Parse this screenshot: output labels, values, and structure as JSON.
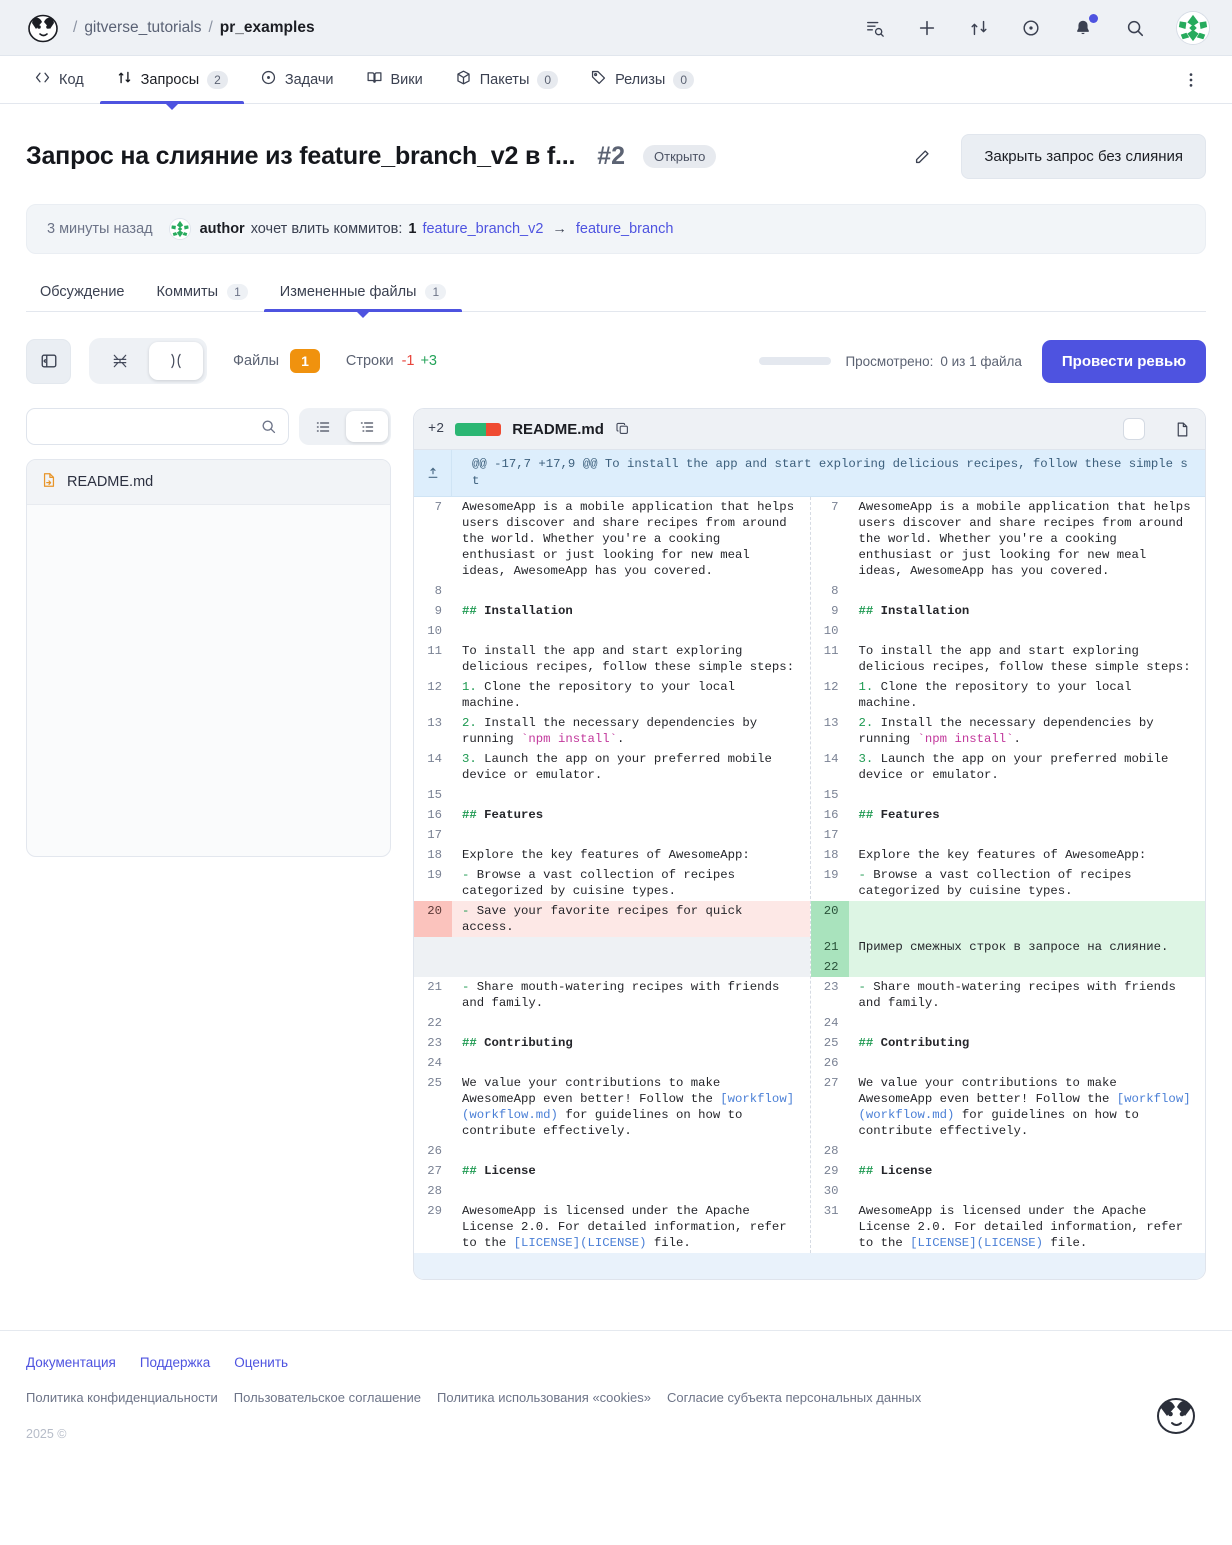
{
  "topbar": {
    "breadcrumb": {
      "org": "gitverse_tutorials",
      "repo": "pr_examples",
      "sep": "/"
    },
    "actions": [
      {
        "name": "list-search-icon",
        "label": "Поиск по списку"
      },
      {
        "name": "plus-icon",
        "label": "Создать"
      },
      {
        "name": "pull-request-icon",
        "label": "Запросы на слияние"
      },
      {
        "name": "issues-icon",
        "label": "Задачи"
      },
      {
        "name": "bell-icon",
        "label": "Уведомления"
      },
      {
        "name": "search-icon",
        "label": "Поиск"
      }
    ]
  },
  "repo_nav": {
    "items": [
      {
        "label": "Код",
        "count": null,
        "icon": "code-icon",
        "active": false
      },
      {
        "label": "Запросы",
        "count": "2",
        "icon": "pull-request-icon",
        "active": true
      },
      {
        "label": "Задачи",
        "count": null,
        "icon": "issues-icon",
        "active": false
      },
      {
        "label": "Вики",
        "count": null,
        "icon": "book-icon",
        "active": false
      },
      {
        "label": "Пакеты",
        "count": "0",
        "icon": "package-icon",
        "active": false
      },
      {
        "label": "Релизы",
        "count": "0",
        "icon": "tag-icon",
        "active": false
      }
    ]
  },
  "pr": {
    "title": "Запрос на слияние из feature_branch_v2 в f...",
    "number": "#2",
    "state": "Открыто",
    "close_button": "Закрыть запрос без слияния",
    "meta": {
      "time": "3 минуты назад",
      "author": "author",
      "text": "хочет влить коммитов:",
      "commits": "1",
      "source_branch": "feature_branch_v2",
      "arrow": "→",
      "target_branch": "feature_branch"
    }
  },
  "subtabs": [
    {
      "label": "Обсуждение",
      "count": null,
      "active": false
    },
    {
      "label": "Коммиты",
      "count": "1",
      "active": false
    },
    {
      "label": "Измененные файлы",
      "count": "1",
      "active": true
    }
  ],
  "toolbar": {
    "collapse_icon": "sidebar-collapse-icon",
    "view_unified": "unified-view-icon",
    "view_split": "split-view-icon",
    "files_label": "Файлы",
    "files_count": "1",
    "lines_label": "Строки",
    "lines_deleted": "-1",
    "lines_added": "+3",
    "viewed_label": "Просмотрено:",
    "viewed_value": "0 из 1 файла",
    "review_button": "Провести ревью"
  },
  "filepane": {
    "search_placeholder": "",
    "search_value": "",
    "view_flat": "flat-list-icon",
    "view_tree": "tree-list-icon",
    "files": [
      {
        "name": "README.md",
        "status": "modified"
      }
    ]
  },
  "diff": {
    "added_count": "+2",
    "filename": "README.md",
    "copy_icon": "copy-icon",
    "viewed_checkbox": false,
    "file_icon": "file-icon",
    "hunk_header": "@@ -17,7 +17,9 @@ To install the app and start exploring delicious recipes, follow these simple st",
    "left": [
      {
        "n": "7",
        "type": "ctx",
        "text": "AwesomeApp is a mobile application that helps users discover and share recipes from around the world. Whether you're a cooking enthusiast or just looking for new meal ideas, AwesomeApp has you covered."
      },
      {
        "n": "8",
        "type": "ctx",
        "text": ""
      },
      {
        "n": "9",
        "type": "ctx",
        "text": "## Installation",
        "md": "heading"
      },
      {
        "n": "10",
        "type": "ctx",
        "text": ""
      },
      {
        "n": "11",
        "type": "ctx",
        "text": "To install the app and start exploring delicious recipes, follow these simple steps:"
      },
      {
        "n": "12",
        "type": "ctx",
        "text": "1. Clone the repository to your local machine.",
        "md": "ol"
      },
      {
        "n": "13",
        "type": "ctx",
        "text": "2. Install the necessary dependencies by running `npm install`.",
        "md": "ol-code"
      },
      {
        "n": "14",
        "type": "ctx",
        "text": "3. Launch the app on your preferred mobile device or emulator.",
        "md": "ol"
      },
      {
        "n": "15",
        "type": "ctx",
        "text": ""
      },
      {
        "n": "16",
        "type": "ctx",
        "text": "## Features",
        "md": "heading"
      },
      {
        "n": "17",
        "type": "ctx",
        "text": ""
      },
      {
        "n": "18",
        "type": "ctx",
        "text": "Explore the key features of AwesomeApp:"
      },
      {
        "n": "19",
        "type": "ctx",
        "text": "- Browse a vast collection of recipes categorized by cuisine types.",
        "md": "ul"
      },
      {
        "n": "20",
        "type": "del",
        "text": "- Save your favorite recipes for quick access.",
        "md": "ul"
      },
      {
        "n": "",
        "type": "empty",
        "text": ""
      },
      {
        "n": "",
        "type": "empty",
        "text": ""
      },
      {
        "n": "21",
        "type": "ctx",
        "text": "- Share mouth-watering recipes with friends and family.",
        "md": "ul"
      },
      {
        "n": "22",
        "type": "ctx",
        "text": ""
      },
      {
        "n": "23",
        "type": "ctx",
        "text": "## Contributing",
        "md": "heading"
      },
      {
        "n": "24",
        "type": "ctx",
        "text": ""
      },
      {
        "n": "25",
        "type": "ctx",
        "text": "We value your contributions to make AwesomeApp even better! Follow the [workflow](workflow.md) for guidelines on how to contribute effectively.",
        "md": "link"
      },
      {
        "n": "26",
        "type": "ctx",
        "text": ""
      },
      {
        "n": "27",
        "type": "ctx",
        "text": "## License",
        "md": "heading"
      },
      {
        "n": "28",
        "type": "ctx",
        "text": ""
      },
      {
        "n": "29",
        "type": "ctx",
        "text": "AwesomeApp is licensed under the Apache License 2.0. For detailed information, refer to the [LICENSE](LICENSE) file.",
        "md": "link2"
      }
    ],
    "right": [
      {
        "n": "7",
        "type": "ctx",
        "text": "AwesomeApp is a mobile application that helps users discover and share recipes from around the world. Whether you're a cooking enthusiast or just looking for new meal ideas, AwesomeApp has you covered."
      },
      {
        "n": "8",
        "type": "ctx",
        "text": ""
      },
      {
        "n": "9",
        "type": "ctx",
        "text": "## Installation",
        "md": "heading"
      },
      {
        "n": "10",
        "type": "ctx",
        "text": ""
      },
      {
        "n": "11",
        "type": "ctx",
        "text": "To install the app and start exploring delicious recipes, follow these simple steps:"
      },
      {
        "n": "12",
        "type": "ctx",
        "text": "1. Clone the repository to your local machine.",
        "md": "ol"
      },
      {
        "n": "13",
        "type": "ctx",
        "text": "2. Install the necessary dependencies by running `npm install`.",
        "md": "ol-code"
      },
      {
        "n": "14",
        "type": "ctx",
        "text": "3. Launch the app on your preferred mobile device or emulator.",
        "md": "ol"
      },
      {
        "n": "15",
        "type": "ctx",
        "text": ""
      },
      {
        "n": "16",
        "type": "ctx",
        "text": "## Features",
        "md": "heading"
      },
      {
        "n": "17",
        "type": "ctx",
        "text": ""
      },
      {
        "n": "18",
        "type": "ctx",
        "text": "Explore the key features of AwesomeApp:"
      },
      {
        "n": "19",
        "type": "ctx",
        "text": "- Browse a vast collection of recipes categorized by cuisine types.",
        "md": "ul"
      },
      {
        "n": "20",
        "type": "add",
        "text": ""
      },
      {
        "n": "21",
        "type": "add",
        "text": "Пример смежных строк в запросе на слияние."
      },
      {
        "n": "22",
        "type": "add",
        "text": ""
      },
      {
        "n": "23",
        "type": "ctx",
        "text": "- Share mouth-watering recipes with friends and family.",
        "md": "ul"
      },
      {
        "n": "24",
        "type": "ctx",
        "text": ""
      },
      {
        "n": "25",
        "type": "ctx",
        "text": "## Contributing",
        "md": "heading"
      },
      {
        "n": "26",
        "type": "ctx",
        "text": ""
      },
      {
        "n": "27",
        "type": "ctx",
        "text": "We value your contributions to make AwesomeApp even better! Follow the [workflow](workflow.md) for guidelines on how to contribute effectively.",
        "md": "link"
      },
      {
        "n": "28",
        "type": "ctx",
        "text": ""
      },
      {
        "n": "29",
        "type": "ctx",
        "text": "## License",
        "md": "heading"
      },
      {
        "n": "30",
        "type": "ctx",
        "text": ""
      },
      {
        "n": "31",
        "type": "ctx",
        "text": "AwesomeApp is licensed under the Apache License 2.0. For detailed information, refer to the [LICENSE](LICENSE) file.",
        "md": "link2"
      }
    ]
  },
  "footer": {
    "primary_links": [
      "Документация",
      "Поддержка",
      "Оценить"
    ],
    "secondary_links": [
      "Политика конфиденциальности",
      "Пользовательское соглашение",
      "Политика использования «cookies»",
      "Согласие субъекта персональных данных"
    ],
    "copyright": "2025 ©"
  },
  "colors": {
    "accent": "#4e53e0",
    "added": "#25a35a",
    "deleted": "#e8453c",
    "warning": "#f0920e"
  }
}
